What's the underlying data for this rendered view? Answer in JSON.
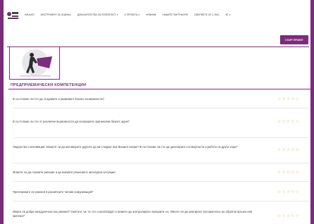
{
  "nav": {
    "items": [
      "НАЧАЛО",
      "ИНСТРУМЕНТ ЗА ОЦЕНКА",
      "ДОКАЗАТЕЛСТВА ЗА ПОЛЕЗНОСТ ▾",
      "О ПРОЕКТА ▾",
      "НОВИНИ",
      "НАШИТЕ ПАРТНЬОРИ",
      "СВЪРЖЕТЕ СЕ С НАС",
      "БГ ▾"
    ]
  },
  "header": {
    "action_button_label": "СТАРТ ПРОЕКТ"
  },
  "section": {
    "title": "ПРЕДПРИЕМАЧЕСКИ КОМПЕТЕНЦИИ"
  },
  "questions": [
    {
      "text": "В състояние ли сте да създавате и развивате бизнес възможности?",
      "rating": 0
    },
    {
      "text": "В състояние ли сте от различни възможности да генерирате оригинални бизнес идеи?",
      "rating": 0
    },
    {
      "text": "Лидерство и мотивация: Можете ли да мотивирате другите да ви следват във Вашите визии? В състояние ли сте да делегирате отговорности и работа на други хора?",
      "rating": 0
    },
    {
      "text": "Можете ли да поемате рискове и да вземате решения в несигурна ситуация.",
      "rating": 0
    },
    {
      "text": "Притежавате ли умения в различните типове комуникация?",
      "rating": 0
    },
    {
      "text": "Имате ли добри междуличностни умения? Смятате ли, че сте съвсоблюдат и можете да контролирате емоциите си. Умеете ли да реагирате положително на обратна връзка или критика?",
      "rating": 0
    }
  ],
  "colors": {
    "brand": "#7b2c7a",
    "star": "#e0b54c"
  }
}
